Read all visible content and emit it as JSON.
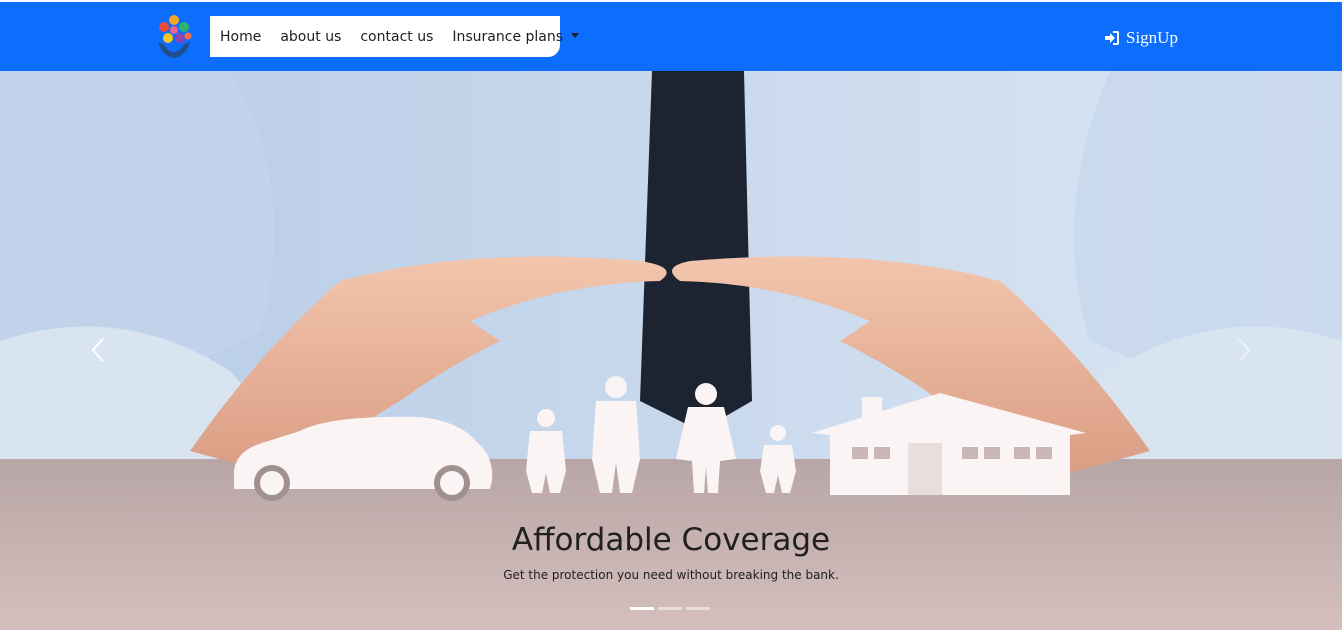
{
  "navbar": {
    "background": "#0d6efd",
    "links": [
      {
        "label": "Home"
      },
      {
        "label": "about us"
      },
      {
        "label": "contact us"
      },
      {
        "label": "Insurance plans"
      }
    ],
    "signup_label": "SignUp"
  },
  "hero": {
    "title": "Affordable Coverage",
    "subtitle": "Get the protection you need without breaking the bank.",
    "slide_count": 3,
    "active_slide": 1
  },
  "icons": {
    "logo": "insurance-logo-icon",
    "signup": "sign-in-icon",
    "dropdown": "caret-down-icon",
    "prev": "chevron-left-icon",
    "next": "chevron-right-icon"
  }
}
